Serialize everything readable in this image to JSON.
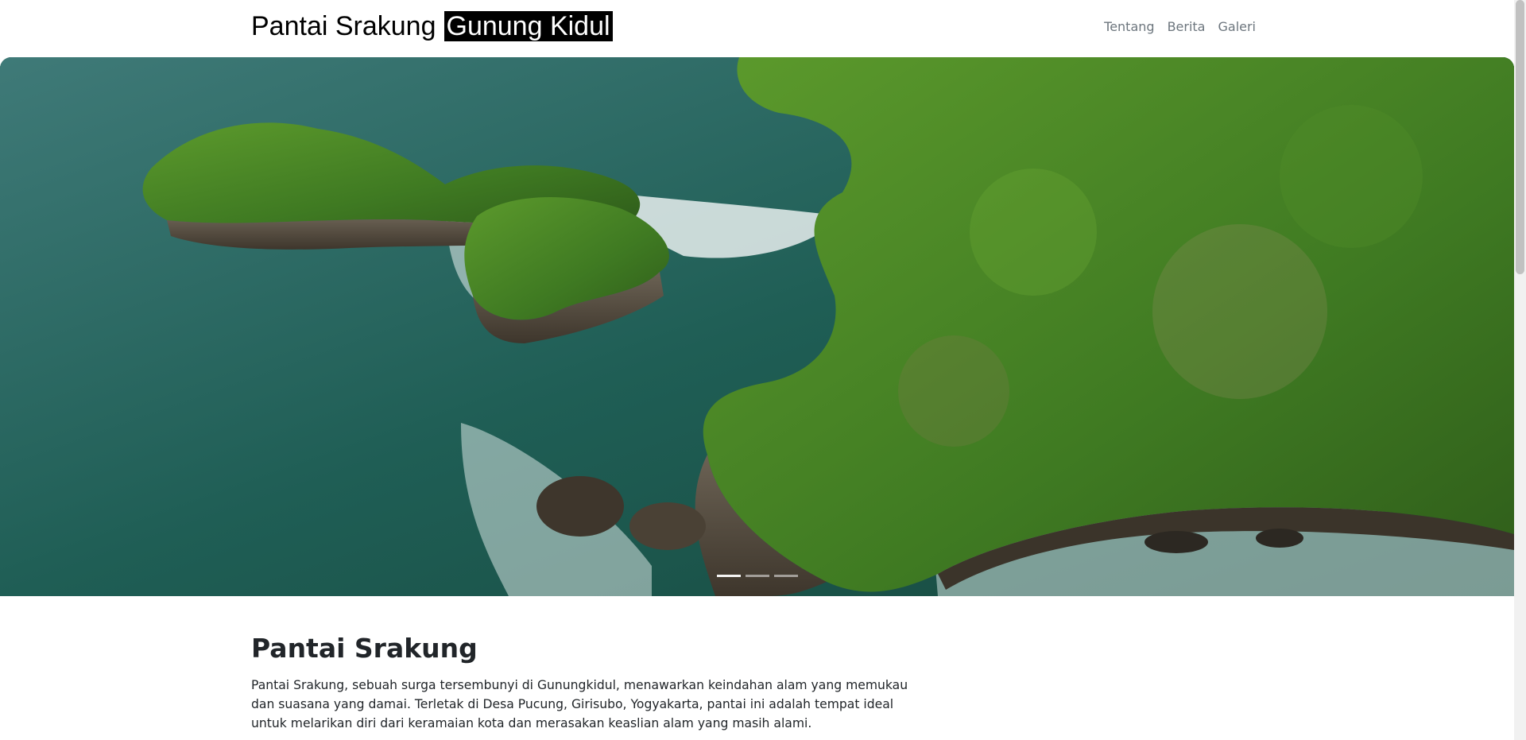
{
  "header": {
    "brand_main": "Pantai Srakung",
    "brand_highlight": "Gunung Kidul",
    "nav": [
      {
        "label": "Tentang"
      },
      {
        "label": "Berita"
      },
      {
        "label": "Galeri"
      }
    ]
  },
  "hero": {
    "image_subject": "aerial-coastal-cliffs",
    "slides_count": 3,
    "active_slide": 1
  },
  "main": {
    "title": "Pantai Srakung",
    "paragraph": "Pantai Srakung, sebuah surga tersembunyi di Gunungkidul, menawarkan keindahan alam yang memukau dan suasana yang damai. Terletak di Desa Pucung, Girisubo, Yogyakarta, pantai ini adalah tempat ideal untuk melarikan diri dari keramaian kota dan merasakan keaslian alam yang masih alami."
  },
  "colors": {
    "nav_link": "#6c757d",
    "text": "#212529",
    "brand_highlight_bg": "#000000"
  }
}
